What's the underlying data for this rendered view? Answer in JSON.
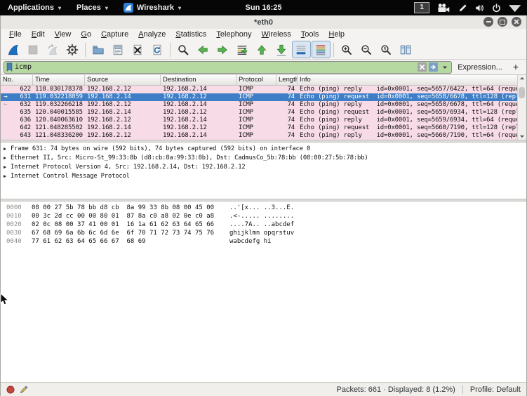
{
  "top_bar": {
    "left": [
      {
        "label": "Applications",
        "icon": null
      },
      {
        "label": "Places",
        "icon": null
      },
      {
        "label": "Wireshark",
        "icon": "wireshark-logo"
      }
    ],
    "clock": "Sun 16:25",
    "workspace": "1",
    "right_icons": [
      "camcorder",
      "pen",
      "volume",
      "power",
      "caret-down-white"
    ]
  },
  "window": {
    "title": "*eth0",
    "controls": [
      "minimize",
      "maximize",
      "close"
    ]
  },
  "menubar": {
    "items": [
      "File",
      "Edit",
      "View",
      "Go",
      "Capture",
      "Analyze",
      "Statistics",
      "Telephony",
      "Wireless",
      "Tools",
      "Help"
    ]
  },
  "toolbar": {
    "buttons": [
      {
        "name": "start-capture",
        "icon": "fin-blue"
      },
      {
        "name": "stop-capture",
        "icon": "stop",
        "disabled": true
      },
      {
        "name": "restart-capture",
        "icon": "fin-restart",
        "disabled": true
      },
      {
        "name": "capture-options",
        "icon": "gear"
      },
      {
        "sep": true
      },
      {
        "name": "open-file",
        "icon": "folder"
      },
      {
        "name": "save-file",
        "icon": "save"
      },
      {
        "name": "close-file",
        "icon": "close-doc"
      },
      {
        "name": "reload-file",
        "icon": "reload-doc"
      },
      {
        "sep": true
      },
      {
        "name": "find-packet",
        "icon": "find"
      },
      {
        "name": "go-previous-packet",
        "icon": "arrow-left"
      },
      {
        "name": "go-next-packet",
        "icon": "arrow-right"
      },
      {
        "name": "go-to-packet",
        "icon": "goto"
      },
      {
        "name": "go-first-packet",
        "icon": "arrow-up"
      },
      {
        "name": "go-last-packet",
        "icon": "arrow-down"
      },
      {
        "name": "auto-scroll",
        "icon": "autoscroll",
        "pressed": true
      },
      {
        "name": "colorize-packets",
        "icon": "colorize",
        "pressed": true
      },
      {
        "sep": true
      },
      {
        "name": "zoom-in",
        "icon": "zoom-in"
      },
      {
        "name": "zoom-out",
        "icon": "zoom-out"
      },
      {
        "name": "zoom-original",
        "icon": "zoom-orig"
      },
      {
        "name": "resize-columns",
        "icon": "resize-cols"
      }
    ]
  },
  "filter": {
    "value": "icmp",
    "expression_label": "Expression...",
    "add_label": "+",
    "valid_bg": "#b5d9a1"
  },
  "packet_list": {
    "columns": [
      {
        "key": "no",
        "label": "No."
      },
      {
        "key": "time",
        "label": "Time"
      },
      {
        "key": "src",
        "label": "Source"
      },
      {
        "key": "dst",
        "label": "Destination"
      },
      {
        "key": "proto",
        "label": "Protocol"
      },
      {
        "key": "len",
        "label": "Length"
      },
      {
        "key": "info",
        "label": "Info"
      }
    ],
    "row_bg": "#f7dbe6",
    "selected_bg": "#3d7ec6",
    "rows": [
      {
        "no": "622",
        "time": "118.030178378",
        "src": "192.168.2.12",
        "dst": "192.168.2.14",
        "proto": "ICMP",
        "len": "74",
        "info": "Echo (ping) reply    id=0x0001, seq=5657/6422, ttl=64 (reque..",
        "marker": "",
        "selected": false
      },
      {
        "no": "631",
        "time": "119.032218059",
        "src": "192.168.2.14",
        "dst": "192.168.2.12",
        "proto": "ICMP",
        "len": "74",
        "info": "Echo (ping) request  id=0x0001, seq=5658/6678, ttl=128 (repl..",
        "marker": "right",
        "selected": true
      },
      {
        "no": "632",
        "time": "119.032266218",
        "src": "192.168.2.12",
        "dst": "192.168.2.14",
        "proto": "ICMP",
        "len": "74",
        "info": "Echo (ping) reply    id=0x0001, seq=5658/6678, ttl=64 (reque..",
        "marker": "left",
        "selected": false
      },
      {
        "no": "635",
        "time": "120.040015585",
        "src": "192.168.2.14",
        "dst": "192.168.2.12",
        "proto": "ICMP",
        "len": "74",
        "info": "Echo (ping) request  id=0x0001, seq=5659/6934, ttl=128 (repl..",
        "marker": "",
        "selected": false
      },
      {
        "no": "636",
        "time": "120.040063610",
        "src": "192.168.2.12",
        "dst": "192.168.2.14",
        "proto": "ICMP",
        "len": "74",
        "info": "Echo (ping) reply    id=0x0001, seq=5659/6934, ttl=64 (reque..",
        "marker": "",
        "selected": false
      },
      {
        "no": "642",
        "time": "121.048285502",
        "src": "192.168.2.14",
        "dst": "192.168.2.12",
        "proto": "ICMP",
        "len": "74",
        "info": "Echo (ping) request  id=0x0001, seq=5660/7190, ttl=128 (repl..",
        "marker": "",
        "selected": false
      },
      {
        "no": "643",
        "time": "121.048336200",
        "src": "192.168.2.12",
        "dst": "192.168.2.14",
        "proto": "ICMP",
        "len": "74",
        "info": "Echo (ping) reply    id=0x0001, seq=5660/7190, ttl=64 (reque..",
        "marker": "",
        "selected": false
      }
    ]
  },
  "details": {
    "lines": [
      "Frame 631: 74 bytes on wire (592 bits), 74 bytes captured (592 bits) on interface 0",
      "Ethernet II, Src: Micro-St_99:33:8b (d8:cb:8a:99:33:8b), Dst: CadmusCo_5b:78:bb (08:00:27:5b:78:bb)",
      "Internet Protocol Version 4, Src: 192.168.2.14, Dst: 192.168.2.12",
      "Internet Control Message Protocol"
    ]
  },
  "hex_dump": {
    "lines": [
      {
        "offset": "0000",
        "hex": "08 00 27 5b 78 bb d8 cb  8a 99 33 8b 08 00 45 00",
        "ascii": "..'[x... ..3...E."
      },
      {
        "offset": "0010",
        "hex": "00 3c 2d cc 00 00 80 01  87 8a c0 a8 02 0e c0 a8",
        "ascii": ".<-..... ........"
      },
      {
        "offset": "0020",
        "hex": "02 0c 08 00 37 41 00 01  16 1a 61 62 63 64 65 66",
        "ascii": "....7A.. ..abcdef"
      },
      {
        "offset": "0030",
        "hex": "67 68 69 6a 6b 6c 6d 6e  6f 70 71 72 73 74 75 76",
        "ascii": "ghijklmn opqrstuv"
      },
      {
        "offset": "0040",
        "hex": "77 61 62 63 64 65 66 67  68 69",
        "ascii": "wabcdefg hi"
      }
    ]
  },
  "status_bar": {
    "packets_text": "Packets: 661 · Displayed: 8 (1.2%)",
    "profile_text": "Profile: Default"
  }
}
